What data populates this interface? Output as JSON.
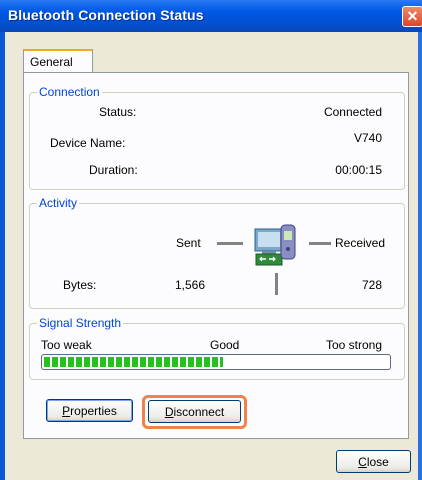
{
  "window": {
    "title": "Bluetooth Connection Status",
    "close_glyph": "✕"
  },
  "tabs": [
    {
      "label": "General",
      "selected": true
    }
  ],
  "connection": {
    "label": "Connection",
    "status_label": "Status:",
    "status_value": "Connected",
    "device_label": "Device Name:",
    "device_value": "V740",
    "duration_label": "Duration:",
    "duration_value": "00:00:15"
  },
  "activity": {
    "label": "Activity",
    "sent_label": "Sent",
    "received_label": "Received",
    "bytes_label": "Bytes:",
    "bytes_sent": "1,566",
    "bytes_received": "728",
    "icon": "bluetooth-device-icon"
  },
  "signal": {
    "label": "Signal Strength",
    "weak_label": "Too weak",
    "good_label": "Good",
    "strong_label": "Too strong",
    "level_fraction": 0.52
  },
  "buttons": {
    "properties_u": "P",
    "properties_rest": "roperties",
    "disconnect_u": "D",
    "disconnect_rest": "isconnect",
    "close_u": "C",
    "close_rest": "lose"
  },
  "colors": {
    "accent": "#0058e6",
    "group_label": "#0046d5",
    "meter": "#25c11f",
    "highlight": "#f0824a"
  }
}
